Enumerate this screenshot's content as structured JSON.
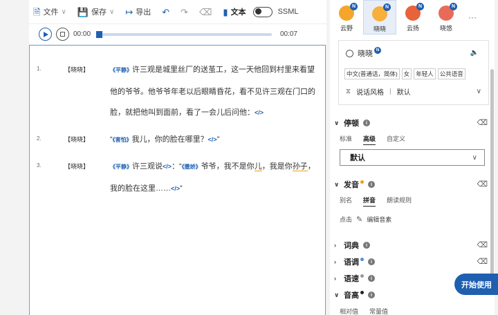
{
  "toolbar": {
    "file_label": "文件",
    "save_label": "保存",
    "export_label": "导出",
    "text_label": "文本",
    "ssml_label": "SSML"
  },
  "player": {
    "current_time": "00:00",
    "end_time": "00:07",
    "progress_fraction": 0.0
  },
  "lines": [
    {
      "number": "1.",
      "speaker": "【晓晓】",
      "segments": [
        {
          "t": "tag",
          "v": "《平静》"
        },
        {
          "t": "text",
          "v": "许三观是城里丝厂的送茧工，这一天他回到村里来看望他的爷爷。他爷爷年老以后眼睛昏花，看不见许三观在门口的脸，就把他叫到面前，看了一会儿后问他："
        },
        {
          "t": "code",
          "v": "</>"
        }
      ]
    },
    {
      "number": "2.",
      "speaker": "【晓晓】",
      "segments": [
        {
          "t": "text",
          "v": "“"
        },
        {
          "t": "tag",
          "v": "《害怕》"
        },
        {
          "t": "text",
          "v": "我儿，你的脸在哪里？"
        },
        {
          "t": "code",
          "v": "</>"
        },
        {
          "t": "text",
          "v": "”"
        }
      ]
    },
    {
      "number": "3.",
      "speaker": "【晓晓】",
      "segments": [
        {
          "t": "tag",
          "v": "《平静》"
        },
        {
          "t": "text",
          "v": "许三观说"
        },
        {
          "t": "code",
          "v": "</>"
        },
        {
          "t": "text",
          "v": "：“"
        },
        {
          "t": "tag",
          "v": "《撒娇》"
        },
        {
          "t": "text",
          "v": "爷爷，我不是你"
        },
        {
          "t": "ul",
          "v": "儿"
        },
        {
          "t": "text",
          "v": "，我是你"
        },
        {
          "t": "ul",
          "v": "孙子"
        },
        {
          "t": "text",
          "v": "，我的脸在这里……"
        },
        {
          "t": "code",
          "v": "</>"
        },
        {
          "t": "text",
          "v": "”"
        }
      ]
    }
  ],
  "voices": [
    {
      "name": "云野",
      "badge": "N",
      "color": "#f4a52a",
      "selected": false
    },
    {
      "name": "晓晓",
      "badge": "N",
      "color": "#f7b03c",
      "selected": true
    },
    {
      "name": "云扬",
      "badge": "N",
      "color": "#e8623a",
      "selected": false
    },
    {
      "name": "晓悠",
      "badge": "N",
      "color": "#e86b5a",
      "selected": false
    }
  ],
  "more_label": "···",
  "voice_card": {
    "name": "晓晓",
    "badge": "N",
    "tags": [
      "中文(普通话，简体)",
      "女",
      "年轻人",
      "公共语音"
    ],
    "style_label": "说话风格",
    "style_sep": "|",
    "style_value": "默认"
  },
  "pause": {
    "title": "停顿",
    "tabs": [
      "标准",
      "高级",
      "自定义"
    ],
    "active_tab": "高级",
    "select_value": "默认"
  },
  "pronunciation": {
    "title": "发音",
    "tabs": [
      "别名",
      "拼音",
      "朗读规则"
    ],
    "active_tab": "拼音",
    "click_label": "点击",
    "edit_label": "编辑音素"
  },
  "dict": {
    "title": "词典"
  },
  "tone": {
    "title": "语调"
  },
  "speed": {
    "title": "语速"
  },
  "pitch": {
    "title": "音高",
    "tabs": [
      "相对值",
      "常量值"
    ]
  },
  "info_glyph": "i",
  "start_button": "开始使用",
  "colors": {
    "accent": "#1f5fb0",
    "orange": "#f0a000"
  }
}
